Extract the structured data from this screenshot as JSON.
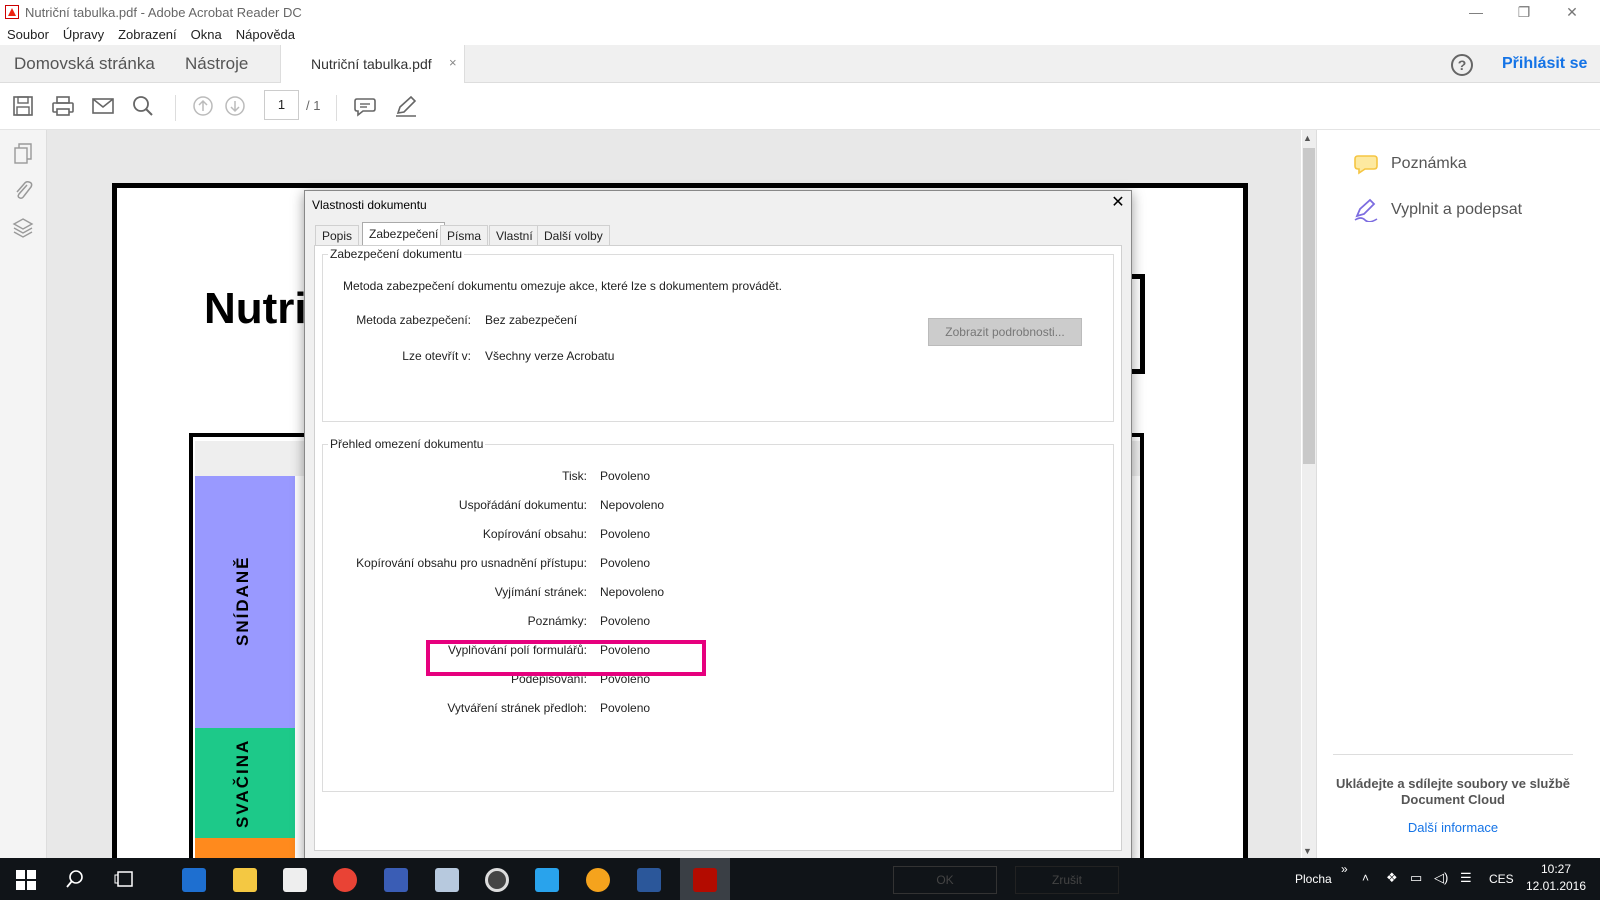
{
  "window": {
    "title": "Nutriční tabulka.pdf - Adobe Acrobat Reader DC",
    "minimize": "—",
    "restore": "❐",
    "close": "✕"
  },
  "menu": [
    "Soubor",
    "Úpravy",
    "Zobrazení",
    "Okna",
    "Nápověda"
  ],
  "tabs": {
    "home": "Domovská stránka",
    "tools": "Nástroje",
    "document": "Nutriční tabulka.pdf",
    "close": "×",
    "help": "?",
    "signin": "Přihlásit se"
  },
  "toolbar": {
    "page_current": "1",
    "page_total": "/ 1"
  },
  "document_page": {
    "title_fragment": "Nutri",
    "band_breakfast": "SNÍDANĚ",
    "band_snack": "SVAČINA",
    "colors": {
      "breakfast": "#9999ff",
      "snack": "#1dc989",
      "lunch": "#ff8a1d"
    }
  },
  "right_panel": {
    "comment": "Poznámka",
    "fill_sign": "Vyplnit a podepsat",
    "cloud_text": "Ukládejte a sdílejte soubory ve službě Document Cloud",
    "more_info": "Další informace"
  },
  "dialog": {
    "title": "Vlastnosti dokumentu",
    "close": "✕",
    "tabs": [
      "Popis",
      "Zabezpečení",
      "Písma",
      "Vlastní",
      "Další volby"
    ],
    "active_tab": "Zabezpečení",
    "security": {
      "group_title": "Zabezpečení dokumentu",
      "description": "Metoda zabezpečení dokumentu omezuje akce, které lze s dokumentem provádět.",
      "method_label": "Metoda zabezpečení:",
      "method_value": "Bez zabezpečení",
      "open_label": "Lze otevřít v:",
      "open_value": "Všechny verze Acrobatu",
      "details_button": "Zobrazit podrobnosti..."
    },
    "restrictions": {
      "group_title": "Přehled omezení dokumentu",
      "rows": [
        {
          "label": "Tisk:",
          "value": "Povoleno"
        },
        {
          "label": "Uspořádání dokumentu:",
          "value": "Nepovoleno"
        },
        {
          "label": "Kopírování obsahu:",
          "value": "Povoleno"
        },
        {
          "label": "Kopírování obsahu pro usnadnění přístupu:",
          "value": "Povoleno"
        },
        {
          "label": "Vyjímání stránek:",
          "value": "Nepovoleno"
        },
        {
          "label": "Poznámky:",
          "value": "Povoleno"
        },
        {
          "label": "Vyplňování polí formulářů:",
          "value": "Povoleno"
        },
        {
          "label": "Podepisování:",
          "value": "Povoleno"
        },
        {
          "label": "Vytváření stránek předloh:",
          "value": "Povoleno"
        }
      ]
    },
    "ok": "OK",
    "cancel": "Zrušit",
    "highlight_color": "#e6007e"
  },
  "taskbar": {
    "desktop": "Plocha",
    "lang": "CES",
    "time": "10:27",
    "date": "12.01.2016",
    "overflow": "»"
  }
}
